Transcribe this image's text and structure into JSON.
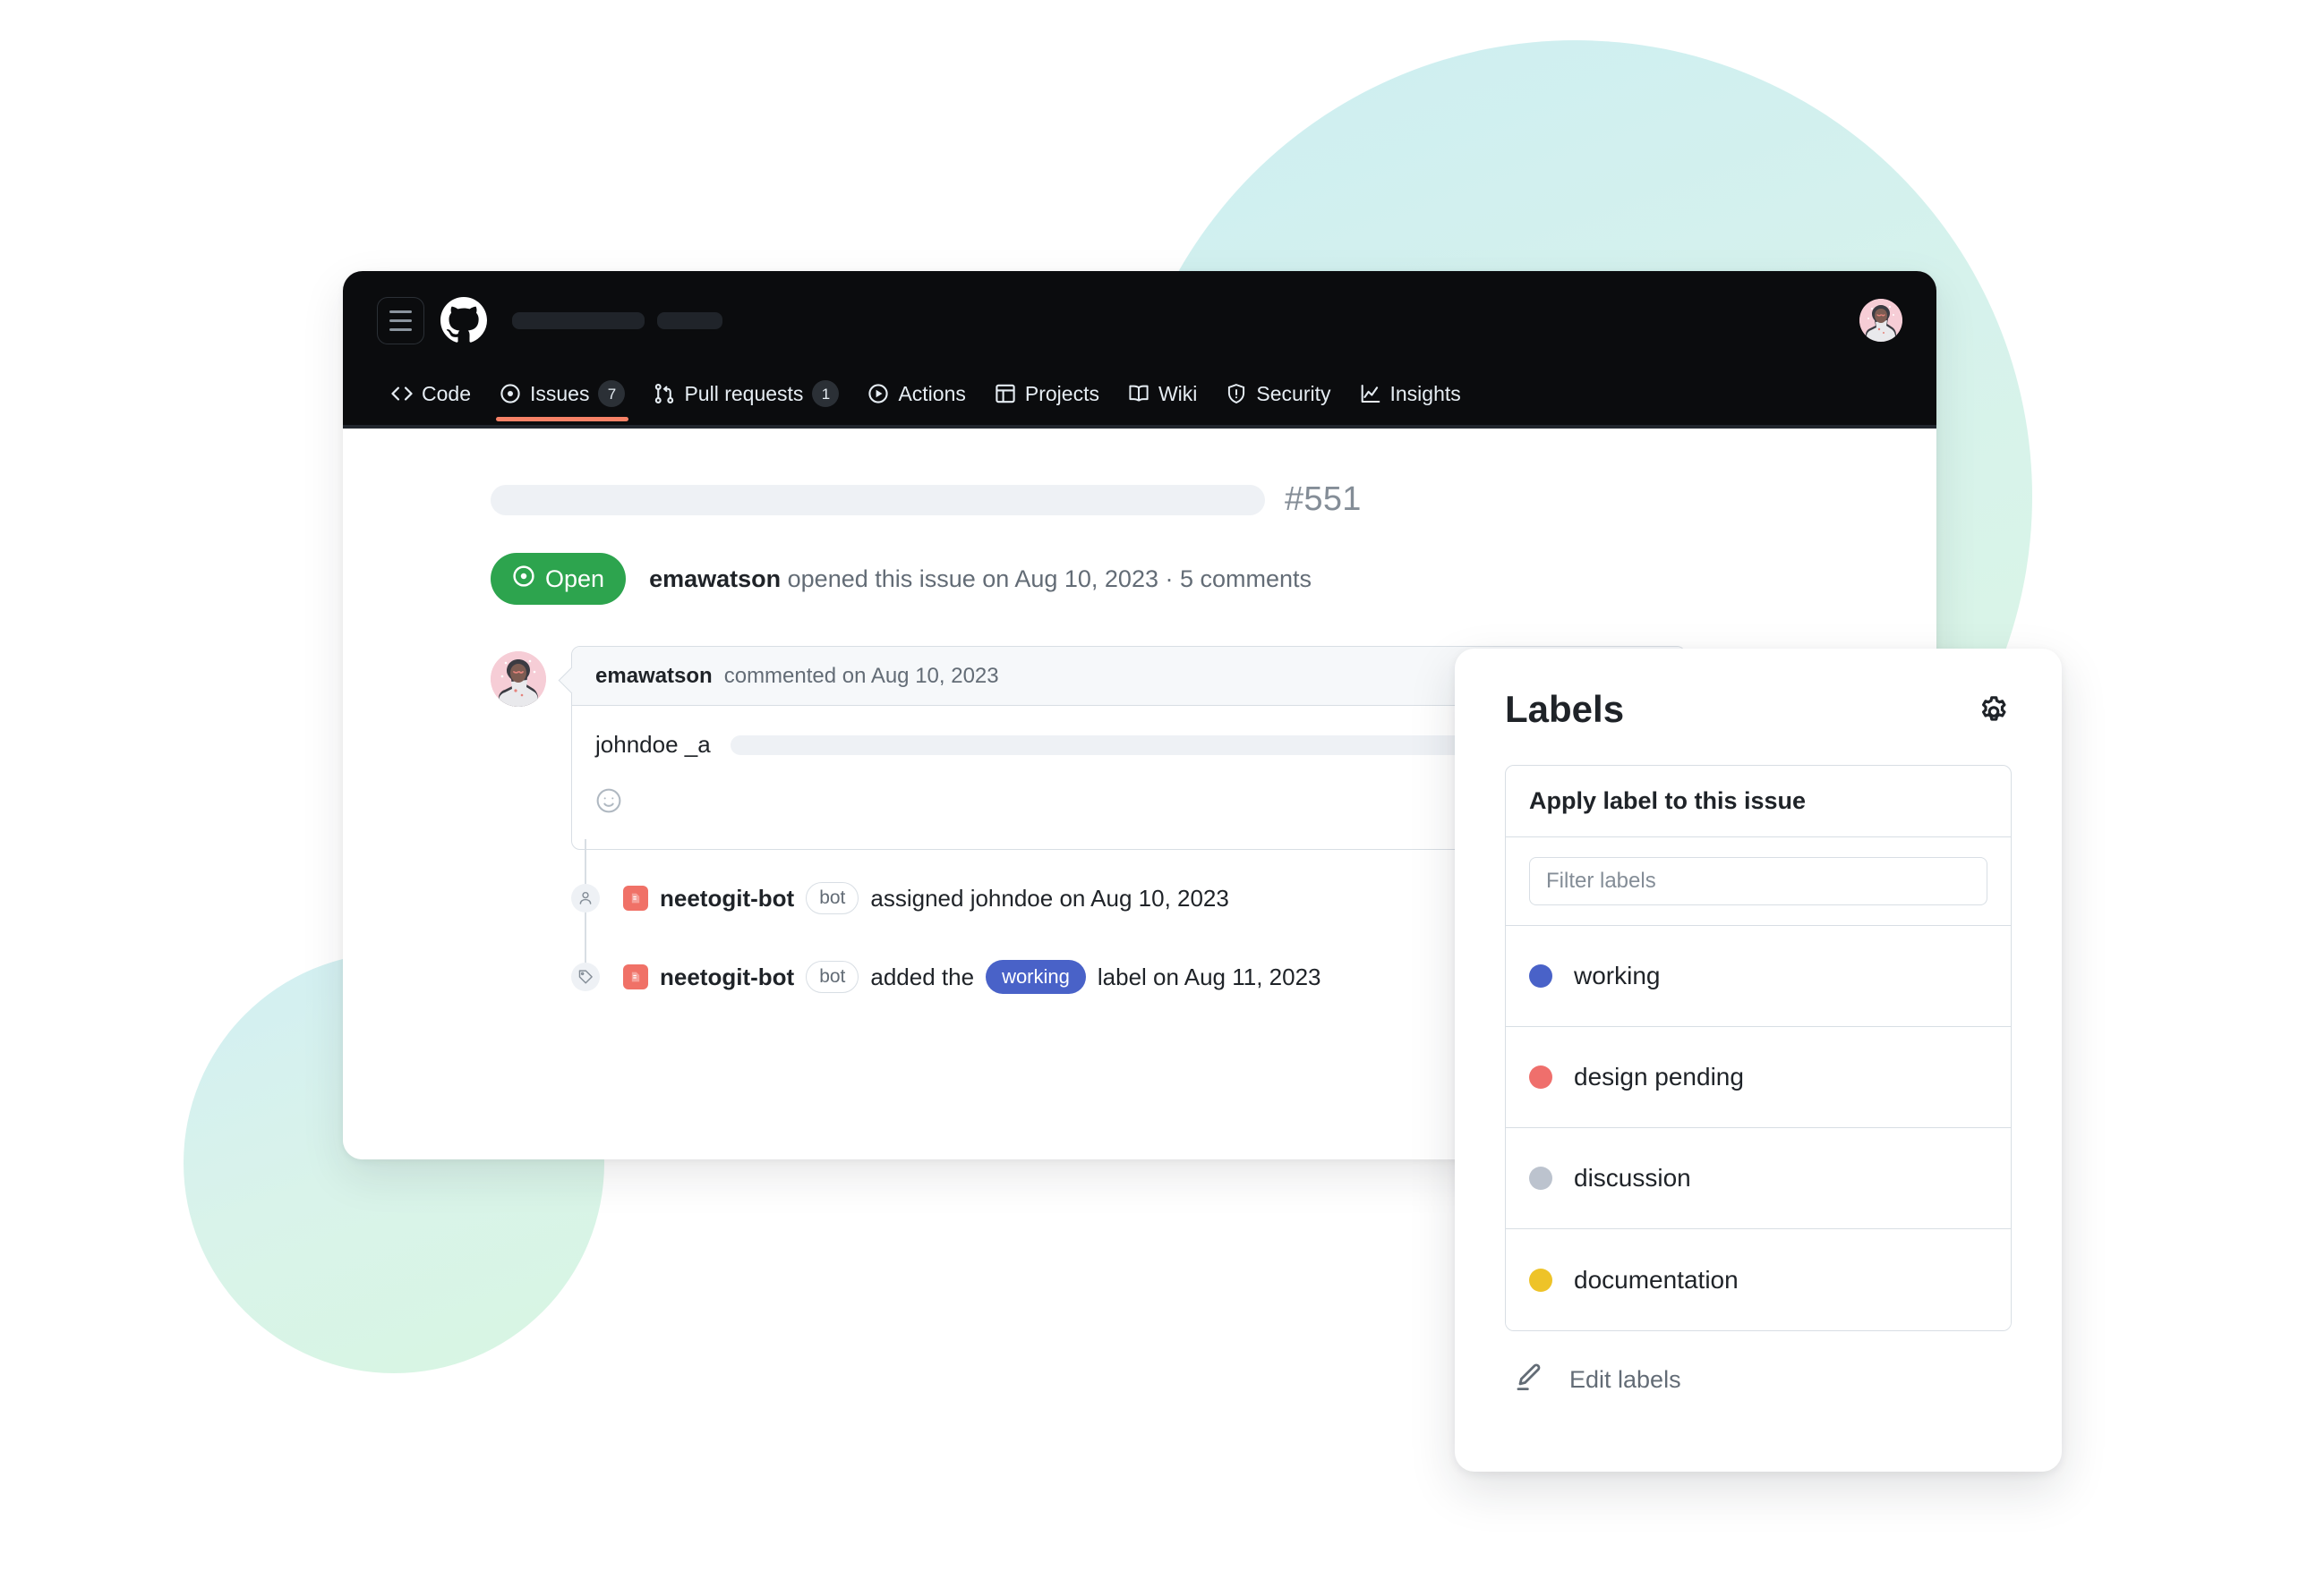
{
  "app": {
    "logo_icon": "github-logo-icon",
    "menu_icon": "hamburger-menu-icon",
    "avatar_icon": "user-avatar"
  },
  "nav": {
    "items": [
      {
        "label": "Code",
        "icon": "code-icon",
        "count": null,
        "selected": false
      },
      {
        "label": "Issues",
        "icon": "issue-opened-icon",
        "count": "7",
        "selected": true
      },
      {
        "label": "Pull requests",
        "icon": "git-pull-request-icon",
        "count": "1",
        "selected": false
      },
      {
        "label": "Actions",
        "icon": "play-icon",
        "count": null,
        "selected": false
      },
      {
        "label": "Projects",
        "icon": "table-icon",
        "count": null,
        "selected": false
      },
      {
        "label": "Wiki",
        "icon": "book-icon",
        "count": null,
        "selected": false
      },
      {
        "label": "Security",
        "icon": "shield-icon",
        "count": null,
        "selected": false
      },
      {
        "label": "Insights",
        "icon": "graph-icon",
        "count": null,
        "selected": false
      }
    ],
    "accent_color": "#f78166"
  },
  "issue": {
    "number": "#551",
    "state_label": "Open",
    "state_color": "#2da44e",
    "author": "emawatson",
    "meta_text": "opened this issue on Aug 10, 2023 · 5 comments",
    "comment": {
      "author": "emawatson",
      "header_suffix": "commented on Aug 10, 2023",
      "mention": "johndoe _a",
      "reaction_icon": "smiley-icon"
    },
    "timeline": [
      {
        "icon": "person-icon",
        "actor": "neetogit-bot",
        "actor_icon": "bot-avatar-icon",
        "tag": "bot",
        "text_before": "assigned johndoe on Aug 10, 2023",
        "chip": null,
        "text_after": null
      },
      {
        "icon": "tag-icon",
        "actor": "neetogit-bot",
        "actor_icon": "bot-avatar-icon",
        "tag": "bot",
        "text_before": "added the",
        "chip": {
          "label": "working",
          "color": "#4962c8"
        },
        "text_after": "label on Aug 11, 2023"
      }
    ]
  },
  "labels_panel": {
    "title": "Labels",
    "settings_icon": "gear-icon",
    "box_header": "Apply label to this issue",
    "filter_placeholder": "Filter labels",
    "filter_value": "",
    "items": [
      {
        "name": "working",
        "color": "#4962c8"
      },
      {
        "name": "design pending",
        "color": "#ef6f6c"
      },
      {
        "name": "discussion",
        "color": "#bcc3ce"
      },
      {
        "name": "documentation",
        "color": "#eec328"
      }
    ],
    "footer": {
      "icon": "pencil-icon",
      "label": "Edit labels"
    }
  }
}
